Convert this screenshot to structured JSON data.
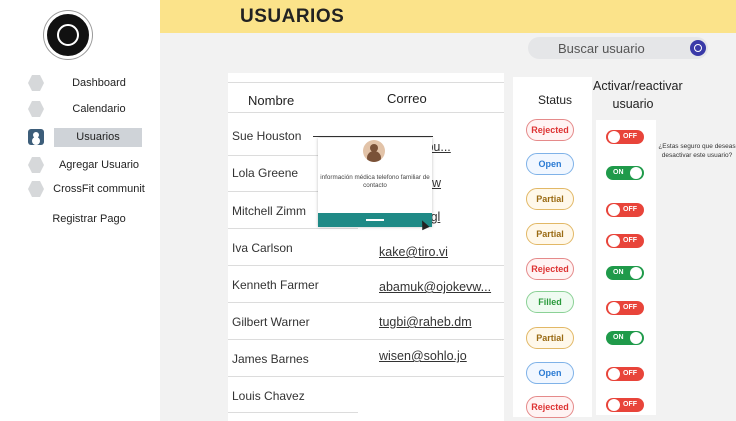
{
  "page": {
    "title": "USUARIOS"
  },
  "logo": {
    "alt": "CrossFit logo"
  },
  "sidebar": {
    "items": [
      {
        "label": "Dashboard",
        "icon": "hexagon-icon"
      },
      {
        "label": "Calendario",
        "icon": "hexagon-icon"
      },
      {
        "label": "Usuarios",
        "icon": "user-icon"
      },
      {
        "label": "Agregar Usuario",
        "icon": "hexagon-icon"
      },
      {
        "label": "CrossFit communit",
        "icon": "hexagon-icon"
      },
      {
        "label": "Registrar Pago",
        "icon": ""
      }
    ]
  },
  "search": {
    "placeholder": "Buscar usuario"
  },
  "table": {
    "headers": {
      "name": "Nombre",
      "email": "Correo",
      "status": "Status",
      "activate": "Activar/reactivar usuario"
    },
    "rows": [
      {
        "name": "Sue Houston",
        "email": "@pudhobu...",
        "status": "Rejected",
        "status_type": "rejected",
        "toggle": "OFF"
      },
      {
        "name": "Lola Greene",
        "email": "ce@ka.mw",
        "status": "Open",
        "status_type": "open",
        "toggle": "ON"
      },
      {
        "name": "Mitchell Zimm",
        "email": "c@sizpe.gl",
        "status": "Partial",
        "status_type": "partial",
        "toggle": "OFF"
      },
      {
        "name": "Iva Carlson",
        "email": "kake@tiro.vi",
        "status": "Partial",
        "status_type": "partial",
        "toggle": "OFF"
      },
      {
        "name": "Kenneth Farmer",
        "email": "abamuk@ojokevw...",
        "status": "Rejected",
        "status_type": "rejected",
        "toggle": "ON"
      },
      {
        "name": "Gilbert Warner",
        "email": "tugbi@raheb.dm",
        "status": "Filled",
        "status_type": "filled",
        "toggle": "OFF"
      },
      {
        "name": "James Barnes",
        "email": "wisen@sohlo.jo",
        "status": "Partial",
        "status_type": "partial",
        "toggle": "ON"
      },
      {
        "name": "Louis Chavez",
        "email": "",
        "status": "Open",
        "status_type": "open",
        "toggle": "OFF"
      },
      {
        "name": "",
        "email": "",
        "status": "Rejected",
        "status_type": "rejected",
        "toggle": "OFF"
      }
    ]
  },
  "confirm": {
    "text": "¿Estas seguro que deseas  desactivar este usuario?"
  },
  "popup": {
    "text": "información médica telefono familiar de contacto"
  },
  "colors": {
    "topbar": "#fbe38a",
    "accent": "#1f8a86",
    "on": "#1f9a4a",
    "off": "#e8443a"
  }
}
